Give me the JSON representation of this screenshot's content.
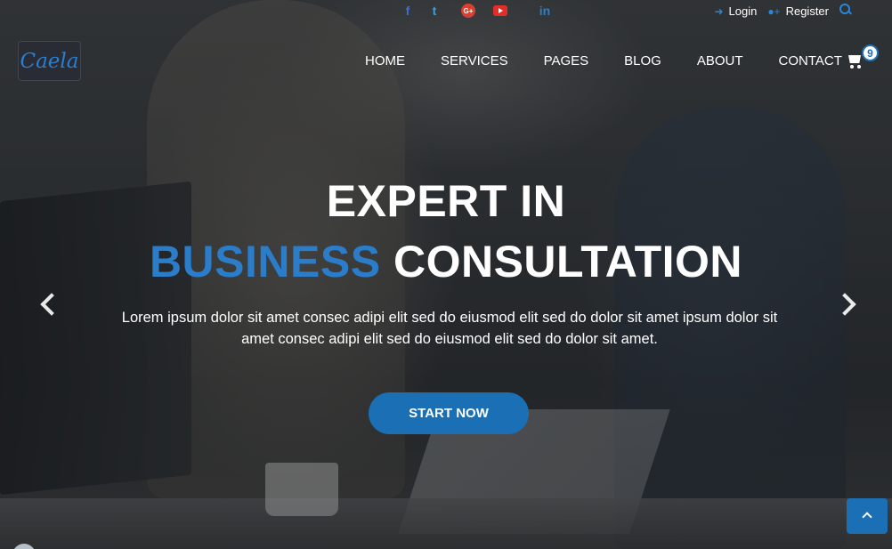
{
  "social": {
    "items": [
      {
        "name": "facebook",
        "glyph": "f"
      },
      {
        "name": "twitter",
        "glyph": "t"
      },
      {
        "name": "google-plus",
        "glyph": "G+"
      },
      {
        "name": "youtube",
        "glyph": ""
      },
      {
        "name": "linkedin",
        "glyph": "in"
      }
    ]
  },
  "account": {
    "login_label": "Login",
    "register_label": "Register"
  },
  "logo": {
    "text": "Caela"
  },
  "nav": {
    "items": [
      "HOME",
      "SERVICES",
      "PAGES",
      "BLOG",
      "ABOUT",
      "CONTACT"
    ]
  },
  "cart": {
    "count": "9"
  },
  "hero": {
    "title_line1": "EXPERT IN",
    "title_accent": "BUSINESS",
    "title_rest": " CONSULTATION",
    "description": "Lorem ipsum dolor sit amet consec adipi elit sed do eiusmod elit sed do dolor sit amet ipsum dolor sit amet consec adipi elit sed do eiusmod elit sed do dolor sit amet.",
    "cta_label": "START NOW"
  },
  "colors": {
    "accent": "#2b7cc9",
    "button": "#1a6fb5"
  }
}
